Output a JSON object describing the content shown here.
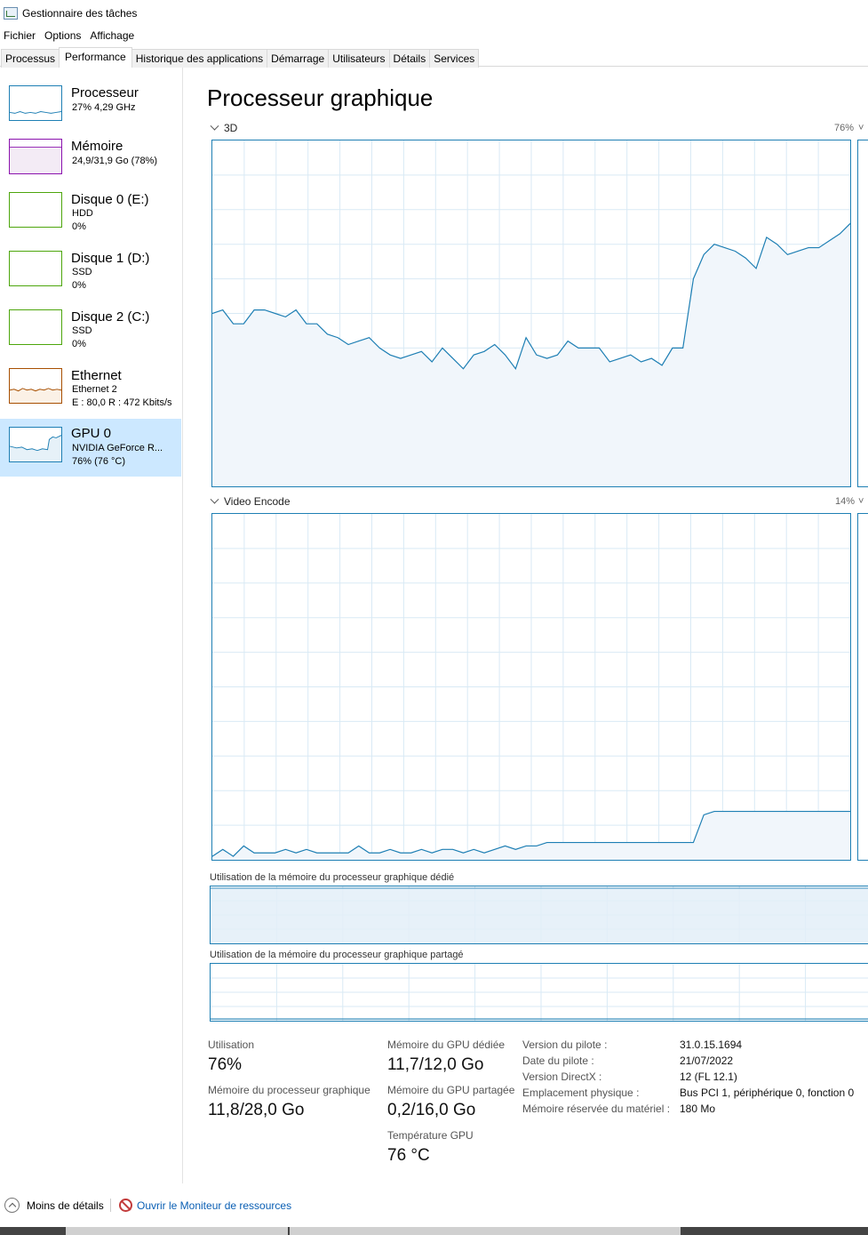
{
  "window": {
    "title": "Gestionnaire des tâches"
  },
  "menu": [
    "Fichier",
    "Options",
    "Affichage"
  ],
  "tabs": [
    "Processus",
    "Performance",
    "Historique des applications",
    "Démarrage",
    "Utilisateurs",
    "Détails",
    "Services"
  ],
  "active_tab": "Performance",
  "sidebar": [
    {
      "title": "Processeur",
      "sub1": "27% 4,29 GHz",
      "sub2": "",
      "color": "#1e7fb4"
    },
    {
      "title": "Mémoire",
      "sub1": "24,9/31,9 Go (78%)",
      "sub2": "",
      "color": "#8b12ae"
    },
    {
      "title": "Disque 0 (E:)",
      "sub1": "HDD",
      "sub2": "0%",
      "color": "#4da60c"
    },
    {
      "title": "Disque 1 (D:)",
      "sub1": "SSD",
      "sub2": "0%",
      "color": "#4da60c"
    },
    {
      "title": "Disque 2 (C:)",
      "sub1": "SSD",
      "sub2": "0%",
      "color": "#4da60c"
    },
    {
      "title": "Ethernet",
      "sub1": "Ethernet 2",
      "sub2": "E : 80,0 R : 472 Kbits/s",
      "color": "#a74f01"
    },
    {
      "title": "GPU 0",
      "sub1": "NVIDIA GeForce R...",
      "sub2": "76% (76 °C)",
      "color": "#1e7fb4"
    }
  ],
  "main": {
    "title": "Processeur graphique",
    "graph1": {
      "label": "3D",
      "percent": "76%"
    },
    "graph2": {
      "label": "Video Encode",
      "percent": "14%"
    },
    "dedicated_label": "Utilisation de la mémoire du processeur graphique dédié",
    "shared_label": "Utilisation de la mémoire du processeur graphique partagé"
  },
  "stats": {
    "utilisation_label": "Utilisation",
    "utilisation_value": "76%",
    "gpu_mem_label": "Mémoire du processeur graphique",
    "gpu_mem_value": "11,8/28,0 Go",
    "dedicated_label": "Mémoire du GPU dédiée",
    "dedicated_value": "11,7/12,0 Go",
    "shared_label": "Mémoire du GPU partagée",
    "shared_value": "0,2/16,0 Go",
    "temp_label": "Température GPU",
    "temp_value": "76 °C"
  },
  "properties": [
    {
      "label": "Version du pilote :",
      "value": "31.0.15.1694"
    },
    {
      "label": "Date du pilote :",
      "value": "21/07/2022"
    },
    {
      "label": "Version DirectX :",
      "value": "12 (FL 12.1)"
    },
    {
      "label": "Emplacement physique :",
      "value": "Bus PCI 1, périphérique 0, fonction 0"
    },
    {
      "label": "Mémoire réservée du matériel :",
      "value": "180 Mo"
    }
  ],
  "footer": {
    "fewer": "Moins de détails",
    "monitor": "Ouvrir le Moniteur de ressources"
  },
  "chart_data": [
    {
      "type": "area",
      "name": "3D",
      "ylim": [
        0,
        100
      ],
      "values": [
        50,
        51,
        47,
        47,
        51,
        51,
        50,
        49,
        51,
        47,
        47,
        44,
        43,
        41,
        42,
        43,
        40,
        38,
        37,
        38,
        39,
        36,
        40,
        37,
        34,
        38,
        39,
        41,
        38,
        34,
        43,
        38,
        37,
        38,
        42,
        40,
        40,
        40,
        36,
        37,
        38,
        36,
        37,
        35,
        40,
        40,
        60,
        67,
        70,
        69,
        68,
        66,
        63,
        72,
        70,
        67,
        68,
        69,
        69,
        71,
        73,
        76
      ]
    },
    {
      "type": "area",
      "name": "Video Encode",
      "ylim": [
        0,
        100
      ],
      "values": [
        1,
        3,
        1,
        4,
        2,
        2,
        2,
        3,
        2,
        3,
        2,
        2,
        2,
        2,
        4,
        2,
        2,
        3,
        2,
        2,
        3,
        2,
        3,
        3,
        2,
        3,
        2,
        3,
        4,
        3,
        4,
        4,
        5,
        5,
        5,
        5,
        5,
        5,
        5,
        5,
        5,
        5,
        5,
        5,
        5,
        5,
        5,
        13,
        14,
        14,
        14,
        14,
        14,
        14,
        14,
        14,
        14,
        14,
        14,
        14,
        14,
        14
      ]
    }
  ]
}
